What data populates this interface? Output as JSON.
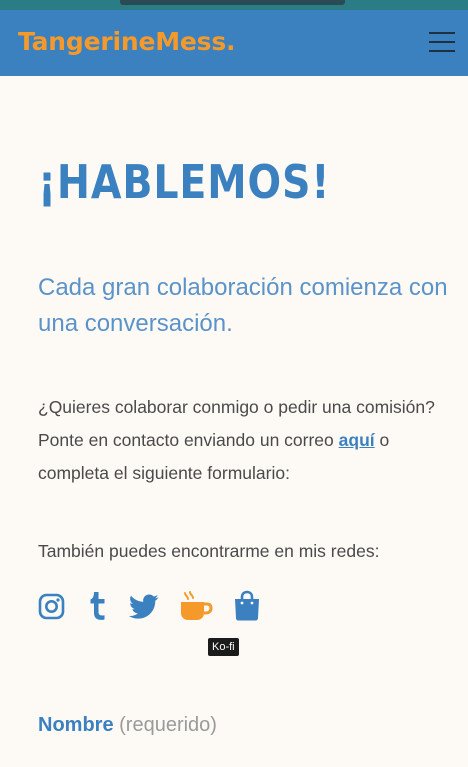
{
  "header": {
    "logo": "TangerineMess.",
    "menu_icon": "hamburger-icon"
  },
  "main": {
    "title": "¡HABLEMOS!",
    "lead": "Cada gran colaboración comienza con una conversación.",
    "para_before": "¿Quieres colaborar conmigo o pedir una comisión? Ponte en contacto enviando un correo ",
    "para_link": "aquí",
    "para_after": " o completa el siguiente formulario:",
    "social_label": "También puedes encontrarme en mis redes:",
    "tooltip": "Ko-fi"
  },
  "socials": [
    {
      "icon": "instagram-icon",
      "color": "#3b80bf"
    },
    {
      "icon": "tumblr-icon",
      "color": "#3b80bf"
    },
    {
      "icon": "twitter-icon",
      "color": "#3b80bf"
    },
    {
      "icon": "kofi-icon",
      "color": "#f59a2a"
    },
    {
      "icon": "shop-bag-icon",
      "color": "#3b80bf"
    }
  ],
  "form": {
    "name_label": "Nombre",
    "required_label": "(requerido)"
  },
  "colors": {
    "accent": "#3b80bf",
    "brand_orange": "#f59a2a",
    "background": "#fdfaf6"
  }
}
